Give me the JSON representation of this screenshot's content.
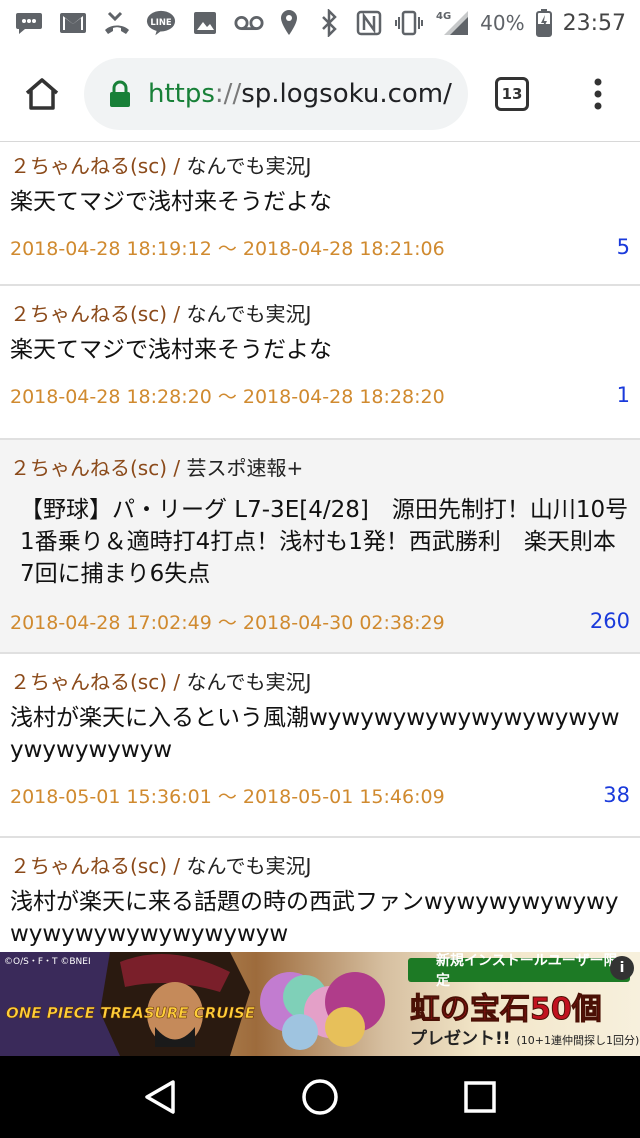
{
  "status_bar": {
    "battery": "40%",
    "time": "23:57",
    "network": "4G",
    "icons": [
      "message-icon",
      "gmail-icon",
      "missed-call-icon",
      "line-icon",
      "image-icon",
      "voicemail-icon",
      "location-icon",
      "bluetooth-icon",
      "nfc-icon",
      "vibrate-icon",
      "signal-icon",
      "battery-icon"
    ]
  },
  "browser": {
    "url_scheme": "https",
    "url_sep": "://",
    "url_host": "sp.logsoku.com/",
    "tab_count": "13"
  },
  "threads": [
    {
      "board": "２ちゃんねる(sc)",
      "sep": " / ",
      "category": "なんでも実況J",
      "title": "楽天てマジで浅村来そうだよな",
      "dates": "2018-04-28 18:19:12 〜 2018-04-28 18:21:06",
      "count": "5"
    },
    {
      "board": "２ちゃんねる(sc)",
      "sep": " / ",
      "category": "なんでも実況J",
      "title": "楽天てマジで浅村来そうだよな",
      "dates": "2018-04-28 18:28:20 〜 2018-04-28 18:28:20",
      "count": "1"
    },
    {
      "board": "２ちゃんねる(sc)",
      "sep": " / ",
      "category": "芸スポ速報+",
      "title": "【野球】パ・リーグ L7-3E[4/28]　源田先制打！山川10号1番乗り＆適時打4打点！浅村も1発！西武勝利　楽天則本7回に捕まり6失点",
      "dates": "2018-04-28 17:02:49 〜 2018-04-30 02:38:29",
      "count": "260"
    },
    {
      "board": "２ちゃんねる(sc)",
      "sep": " / ",
      "category": "なんでも実況J",
      "title": "浅村が楽天に入るという風潮wywywywywywywywywywywywywywyw",
      "dates": "2018-05-01 15:36:01 〜 2018-05-01 15:46:09",
      "count": "38"
    },
    {
      "board": "２ちゃんねる(sc)",
      "sep": " / ",
      "category": "なんでも実況J",
      "title": "浅村が楽天に来る話題の時の西武ファンwywywywywywywywywywywywywywyw",
      "dates": "",
      "count": ""
    }
  ],
  "ad": {
    "copyright": "©O/S・F・T ©BNEI",
    "logo": "ONE PIECE TREASURE CRUISE",
    "badge": "新規インストールユーザー限定",
    "headline": "虹の宝石50個",
    "sub": "プレゼント!!",
    "sub_small": "(10+1連仲間探し1回分)",
    "info": "i"
  },
  "colors": {
    "board_brown": "#8b4a1a",
    "date_orange": "#d08a2f",
    "count_blue": "#1a3adb",
    "lock_green": "#188038"
  }
}
